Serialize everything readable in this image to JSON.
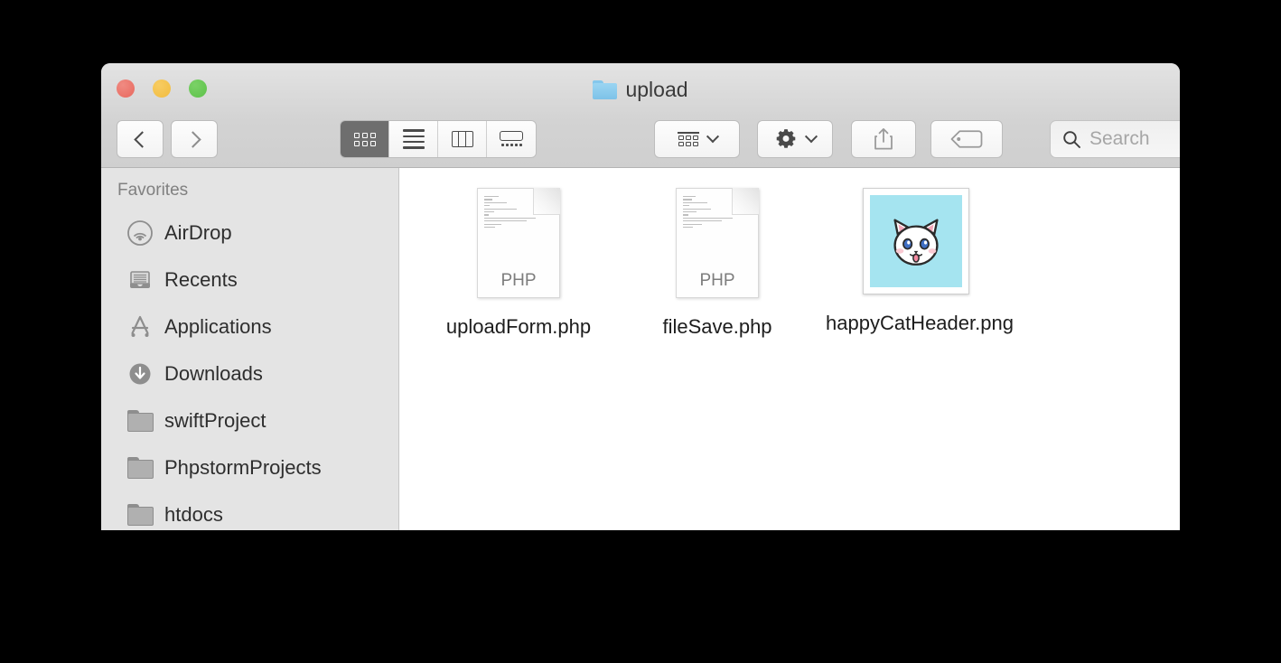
{
  "window": {
    "title": "upload",
    "title_icon": "folder-icon",
    "controls": {
      "close": "close-button",
      "minimize": "minimize-button",
      "maximize": "maximize-button"
    }
  },
  "toolbar": {
    "back_icon": "chevron-left-icon",
    "forward_icon": "chevron-right-icon",
    "view_modes": [
      {
        "name": "icon-view",
        "icon": "grid-icon",
        "active": true
      },
      {
        "name": "list-view",
        "icon": "list-icon",
        "active": false
      },
      {
        "name": "column-view",
        "icon": "columns-icon",
        "active": false
      },
      {
        "name": "gallery-view",
        "icon": "gallery-icon",
        "active": false
      }
    ],
    "arrange_icon": "arrange-grid-icon",
    "action_icon": "gear-icon",
    "share_icon": "share-icon",
    "tag_icon": "tag-icon",
    "dropdown_icon": "chevron-down-icon"
  },
  "search": {
    "icon": "search-icon",
    "value": "",
    "placeholder": "Search"
  },
  "sidebar": {
    "header": "Favorites",
    "items": [
      {
        "label": "AirDrop",
        "icon": "airdrop-icon"
      },
      {
        "label": "Recents",
        "icon": "recents-icon"
      },
      {
        "label": "Applications",
        "icon": "applications-icon"
      },
      {
        "label": "Downloads",
        "icon": "downloads-icon"
      },
      {
        "label": "swiftProject",
        "icon": "folder-icon"
      },
      {
        "label": "PhpstormProjects",
        "icon": "folder-icon"
      },
      {
        "label": "htdocs",
        "icon": "folder-icon"
      }
    ]
  },
  "files": [
    {
      "name": "uploadForm.php",
      "type": "php-document",
      "ext_label": "PHP"
    },
    {
      "name": "fileSave.php",
      "type": "php-document",
      "ext_label": "PHP"
    },
    {
      "name": "happyCatHeader.png",
      "type": "image-thumbnail",
      "ext_label": ""
    }
  ],
  "colors": {
    "close": "#e8685e",
    "minimize": "#f2bc3f",
    "maximize": "#5dc24a",
    "sidebar_bg": "#e4e4e4",
    "toolbar_bg": "#d3d3d3",
    "active_view_bg": "#6e6e6e",
    "thumbnail_bg": "#a5e4f0",
    "folder_blue": "#7dc2e8"
  }
}
